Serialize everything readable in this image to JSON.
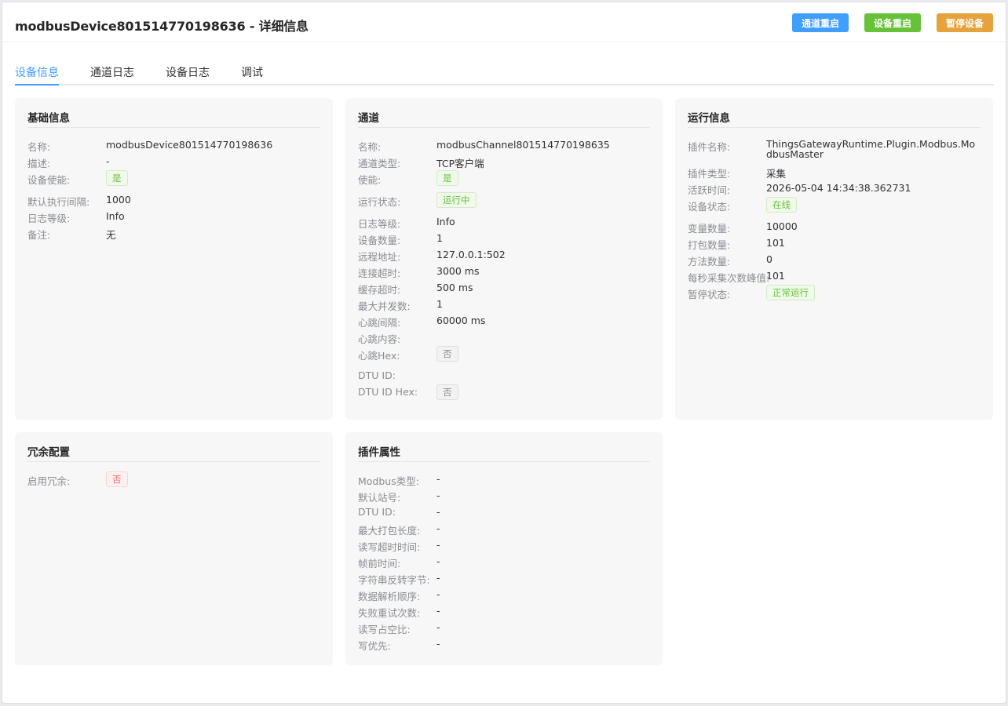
{
  "header": {
    "title": "modbusDevice801514770198636 - 详细信息",
    "buttons": {
      "restart_channel": "通道重启",
      "restart_device": "设备重启",
      "pause_device": "暂停设备"
    }
  },
  "colors": {
    "primary": "#409eff",
    "success": "#67c23a",
    "warning": "#e6a23c",
    "danger": "#f56c6c"
  },
  "tabs": [
    "设备信息",
    "通道日志",
    "设备日志",
    "调试"
  ],
  "basic": {
    "title": "基础信息",
    "rows": [
      {
        "label": "名称:",
        "value": "modbusDevice801514770198636"
      },
      {
        "label": "描述:",
        "value": "-"
      },
      {
        "label": "设备使能:",
        "tag": "是"
      },
      {
        "label": "默认执行间隔:",
        "value": "1000"
      },
      {
        "label": "日志等级:",
        "value": "Info"
      },
      {
        "label": "备注:",
        "value": "无"
      }
    ]
  },
  "channel": {
    "title": "通道",
    "rows": [
      {
        "label": "名称:",
        "value": "modbusChannel801514770198635"
      },
      {
        "label": "通道类型:",
        "value": "TCP客户端"
      },
      {
        "label": "使能:",
        "tag": "是"
      },
      {
        "label": "运行状态:",
        "tag": "运行中"
      },
      {
        "label": "日志等级:",
        "value": "Info"
      },
      {
        "label": "设备数量:",
        "value": "1"
      },
      {
        "label": "远程地址:",
        "value": "127.0.0.1:502"
      },
      {
        "label": "连接超时:",
        "value": "3000 ms"
      },
      {
        "label": "缓存超时:",
        "value": "500 ms"
      },
      {
        "label": "最大并发数:",
        "value": "1"
      },
      {
        "label": "心跳间隔:",
        "value": "60000 ms"
      },
      {
        "label": "心跳内容:",
        "value": ""
      },
      {
        "label": "心跳Hex:",
        "tag": "否"
      },
      {
        "label": "DTU ID:",
        "value": ""
      },
      {
        "label": "DTU ID Hex:",
        "tag": "否"
      }
    ]
  },
  "runtime": {
    "title": "运行信息",
    "rows": [
      {
        "label": "插件名称:",
        "value": "ThingsGatewayRuntime.Plugin.Modbus.ModbusMaster"
      },
      {
        "label": "插件类型:",
        "value": "采集"
      },
      {
        "label": "活跃时间:",
        "value": "2026-05-04 14:34:38.362731"
      },
      {
        "label": "设备状态:",
        "tag": "在线"
      },
      {
        "label": "变量数量:",
        "value": "10000"
      },
      {
        "label": "打包数量:",
        "value": "101"
      },
      {
        "label": "方法数量:",
        "value": "0"
      },
      {
        "label": "每秒采集次数峰值:",
        "value": "101"
      },
      {
        "label": "暂停状态:",
        "tag": "正常运行"
      }
    ]
  },
  "redundancy": {
    "title": "冗余配置",
    "rows": [
      {
        "label": "启用冗余:",
        "tag": "否"
      }
    ]
  },
  "plugin": {
    "title": "插件属性",
    "rows": [
      {
        "label": "Modbus类型:",
        "value": "-"
      },
      {
        "label": "默认站号:",
        "value": "-"
      },
      {
        "label": "DTU ID:",
        "value": "-"
      },
      {
        "label": "最大打包长度:",
        "value": "-"
      },
      {
        "label": "读写超时时间:",
        "value": "-"
      },
      {
        "label": "帧前时间:",
        "value": "-"
      },
      {
        "label": "字符串反转字节:",
        "value": "-"
      },
      {
        "label": "数据解析顺序:",
        "value": "-"
      },
      {
        "label": "失败重试次数:",
        "value": "-"
      },
      {
        "label": "读写占空比:",
        "value": "-"
      },
      {
        "label": "写优先:",
        "value": "-"
      }
    ]
  }
}
